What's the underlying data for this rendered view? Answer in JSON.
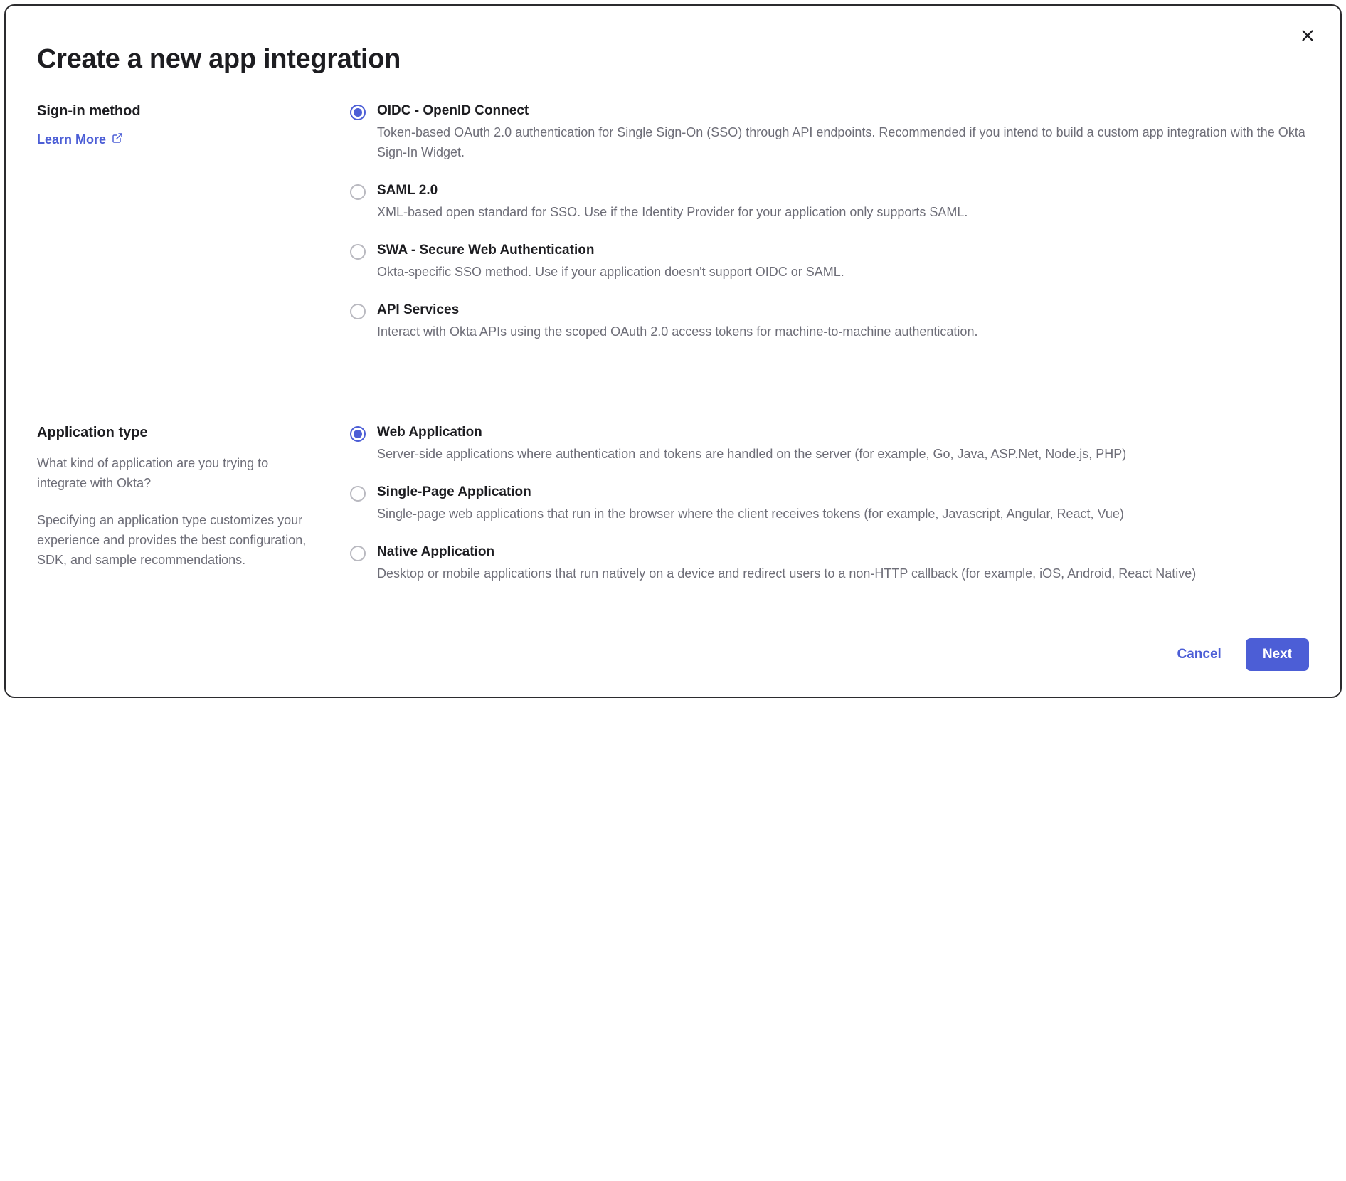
{
  "modal": {
    "title": "Create a new app integration",
    "close_aria": "Close"
  },
  "sign_in_method": {
    "heading": "Sign-in method",
    "learn_more_label": "Learn More",
    "options": [
      {
        "title": "OIDC - OpenID Connect",
        "description": "Token-based OAuth 2.0 authentication for Single Sign-On (SSO) through API endpoints. Recommended if you intend to build a custom app integration with the Okta Sign-In Widget.",
        "selected": true
      },
      {
        "title": "SAML 2.0",
        "description": "XML-based open standard for SSO. Use if the Identity Provider for your application only supports SAML.",
        "selected": false
      },
      {
        "title": "SWA - Secure Web Authentication",
        "description": "Okta-specific SSO method. Use if your application doesn't support OIDC or SAML.",
        "selected": false
      },
      {
        "title": "API Services",
        "description": "Interact with Okta APIs using the scoped OAuth 2.0 access tokens for machine-to-machine authentication.",
        "selected": false
      }
    ]
  },
  "application_type": {
    "heading": "Application type",
    "help1": "What kind of application are you trying to integrate with Okta?",
    "help2": "Specifying an application type customizes your experience and provides the best configuration, SDK, and sample recommendations.",
    "options": [
      {
        "title": "Web Application",
        "description": "Server-side applications where authentication and tokens are handled on the server (for example, Go, Java, ASP.Net, Node.js, PHP)",
        "selected": true
      },
      {
        "title": "Single-Page Application",
        "description": "Single-page web applications that run in the browser where the client receives tokens (for example, Javascript, Angular, React, Vue)",
        "selected": false
      },
      {
        "title": "Native Application",
        "description": "Desktop or mobile applications that run natively on a device and redirect users to a non-HTTP callback (for example, iOS, Android, React Native)",
        "selected": false
      }
    ]
  },
  "footer": {
    "cancel_label": "Cancel",
    "next_label": "Next"
  }
}
